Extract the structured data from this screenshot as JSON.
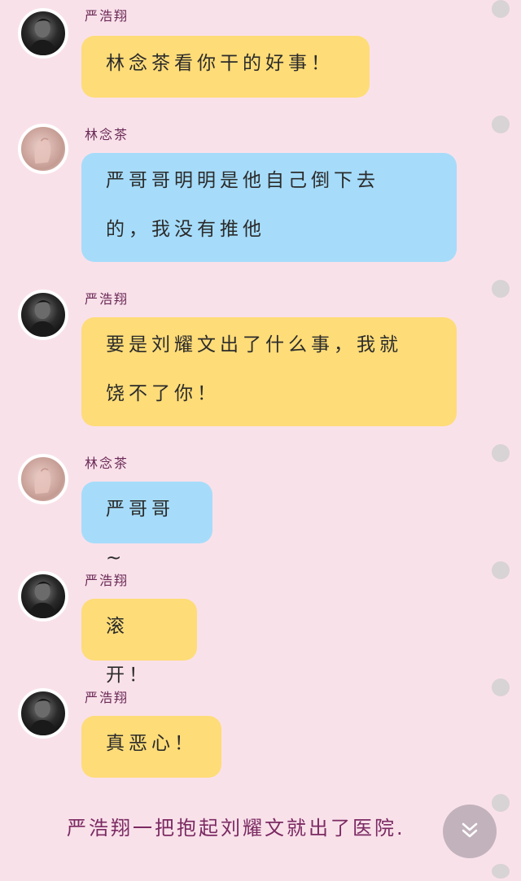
{
  "messages": [
    {
      "sender": "严浩翔",
      "avatar_icon": "boy-portrait-icon",
      "bubble_color": "#fedc78",
      "lines": [
        "林念茶看你干的好事！"
      ]
    },
    {
      "sender": "林念茶",
      "avatar_icon": "girl-hand-portrait-icon",
      "bubble_color": "#a6dcfa",
      "lines": [
        "严哥哥明明是他自己倒下去",
        "的，我没有推他"
      ]
    },
    {
      "sender": "严浩翔",
      "avatar_icon": "boy-portrait-icon",
      "bubble_color": "#fedc78",
      "lines": [
        "要是刘耀文出了什么事，我就",
        "饶不了你！"
      ]
    },
    {
      "sender": "林念茶",
      "avatar_icon": "girl-hand-portrait-icon",
      "bubble_color": "#a6dcfa",
      "lines": [
        "严哥哥~"
      ]
    },
    {
      "sender": "严浩翔",
      "avatar_icon": "boy-portrait-icon",
      "bubble_color": "#fedc78",
      "lines": [
        "滚开！"
      ]
    },
    {
      "sender": "严浩翔",
      "avatar_icon": "boy-portrait-icon",
      "bubble_color": "#fedc78",
      "lines": [
        "真恶心！"
      ]
    }
  ],
  "narration": "严浩翔一把抱起刘耀文就出了医院.",
  "scroll_button_icon": "chevron-double-down-icon",
  "colors": {
    "background": "#f9e1ea",
    "name_text": "#6b2a56",
    "narration_text": "#7b2a62"
  }
}
